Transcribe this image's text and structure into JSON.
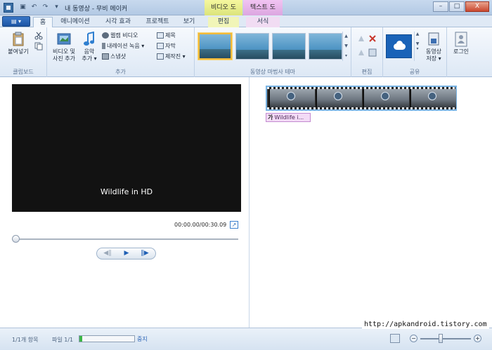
{
  "window": {
    "title": "내 동영상 - 무비 메이커",
    "context_video_tools": "비디오 도구",
    "context_text_tools": "텍스트 도구",
    "minimize": "–",
    "maximize": "□",
    "close": "X"
  },
  "qat": {
    "save": "▣",
    "undo": "↶",
    "redo": "↷",
    "more": "▾"
  },
  "tabs": {
    "file": "▤ ▾",
    "home": "홈",
    "animations": "애니메이션",
    "visual_effects": "시각 효과",
    "project": "프로젝트",
    "view": "보기",
    "edit": "편집",
    "format": "서식"
  },
  "ribbon": {
    "clipboard": {
      "paste": "붙여넣기",
      "label": "클립보드"
    },
    "add": {
      "add_videos_line1": "비디오 및",
      "add_videos_line2": "사진 추가",
      "add_music_line1": "음악",
      "add_music_line2": "추가 ▾",
      "webcam": "웹캠 비디오",
      "narration": "내레이션 녹음 ▾",
      "snapshot": "스냅샷",
      "title": "제목",
      "caption": "자막",
      "credits": "제작진 ▾",
      "label": "추가"
    },
    "themes": {
      "label": "동영상 마법사 테마"
    },
    "editing": {
      "label": "편집"
    },
    "share": {
      "save_movie_line1": "동영상",
      "save_movie_line2": "저장 ▾",
      "label": "공유"
    },
    "signin": {
      "label": "로그인"
    }
  },
  "preview": {
    "caption": "Wildlife in HD",
    "time": "00:00.00/00:30.09",
    "fullscreen": "↗",
    "prev": "◀‖",
    "play": "▶",
    "next": "‖▶",
    "seek_position": 0
  },
  "storyboard": {
    "caption_icon": "가",
    "caption_text": "Wildlife i..."
  },
  "status": {
    "items": "1/1개 항목",
    "file_progress": "파일 1/1",
    "progress_fraction": 0.05,
    "stop": "중지",
    "watermark": "http://apkandroid.tistory.com",
    "zoom_out": "−",
    "zoom_in": "+"
  },
  "colors": {
    "accent": "#1d55a5",
    "selected_theme_border": "#f0b93a",
    "progress_green": "#3cb548"
  }
}
